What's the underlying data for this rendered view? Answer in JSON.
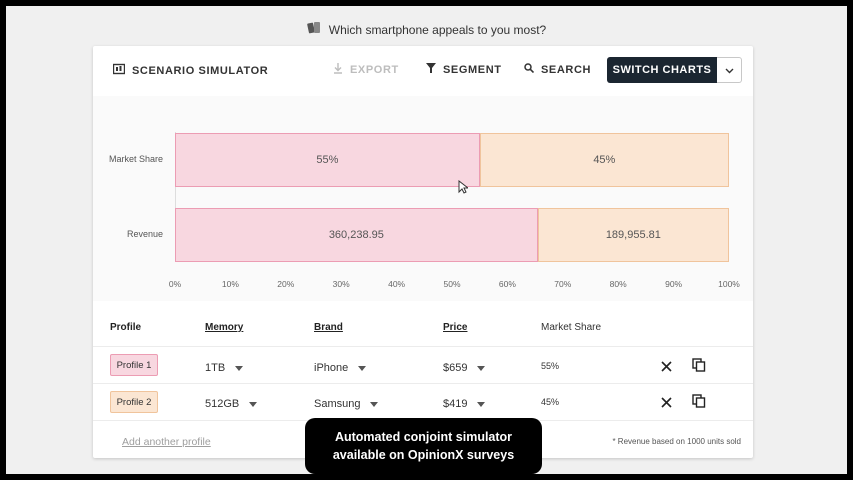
{
  "question": {
    "text": "Which smartphone appeals to you most?",
    "icon": "phones-icon"
  },
  "toolbar": {
    "title": "SCENARIO SIMULATOR",
    "export_label": "EXPORT",
    "segment_label": "SEGMENT",
    "search_label": "SEARCH",
    "switch_label": "SWITCH CHARTS"
  },
  "chart_data": {
    "type": "bar",
    "orientation": "horizontal",
    "stacked": "percent",
    "categories": [
      "Market Share",
      "Revenue"
    ],
    "series": [
      {
        "name": "Profile 1",
        "values": [
          55,
          65.47
        ],
        "labels": [
          "55%",
          "360,238.95"
        ],
        "color": "#f8d7e0"
      },
      {
        "name": "Profile 2",
        "values": [
          45,
          34.53
        ],
        "labels": [
          "45%",
          "189,955.81"
        ],
        "color": "#fbe6d3"
      }
    ],
    "xlim": [
      0,
      100
    ],
    "x_ticks": [
      "0%",
      "10%",
      "20%",
      "30%",
      "40%",
      "50%",
      "60%",
      "70%",
      "80%",
      "90%",
      "100%"
    ],
    "grid": false
  },
  "table": {
    "headers": {
      "profile": "Profile",
      "memory": "Memory",
      "brand": "Brand",
      "price": "Price",
      "share": "Market Share"
    },
    "rows": [
      {
        "profile": "Profile 1",
        "memory": "1TB",
        "brand": "iPhone",
        "price": "$659",
        "share": "55%"
      },
      {
        "profile": "Profile 2",
        "memory": "512GB",
        "brand": "Samsung",
        "price": "$419",
        "share": "45%"
      }
    ],
    "add_label": "Add another profile",
    "footnote": "* Revenue based on 1000 units sold"
  },
  "banner": {
    "line1": "Automated conjoint simulator",
    "line2": "available on OpinionX surveys"
  },
  "colors": {
    "profile1": "#f8d7e0",
    "profile2": "#fbe6d3",
    "dark": "#1b2631"
  }
}
